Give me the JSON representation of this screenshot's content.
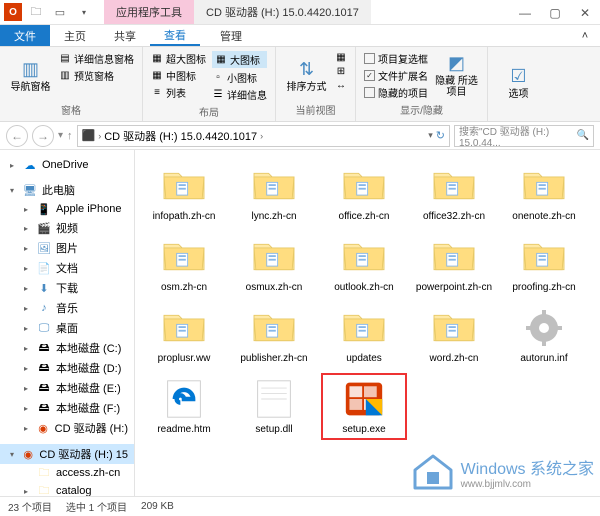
{
  "titlebar": {
    "tool_tab": "应用程序工具",
    "title": "CD 驱动器 (H:) 15.0.4420.1017",
    "manage": "管理"
  },
  "tabs": {
    "file": "文件",
    "home": "主页",
    "share": "共享",
    "view": "查看"
  },
  "ribbon": {
    "nav_pane": "导航窗格",
    "detail_pane": "详细信息窗格",
    "preview_pane": "预览窗格",
    "group_pane": "窗格",
    "extra_large": "超大图标",
    "large": "大图标",
    "medium": "中图标",
    "small": "小图标",
    "list": "列表",
    "details": "详细信息",
    "group_layout": "布局",
    "sort": "排序方式",
    "group_current": "当前视图",
    "item_checkboxes": "项目复选框",
    "file_ext": "文件扩展名",
    "hidden_items": "隐藏的项目",
    "hide_selected": "隐藏\n所选项目",
    "group_showhide": "显示/隐藏",
    "options": "选项"
  },
  "address": {
    "root": "CD 驱动器 (H:) 15.0.4420.1017",
    "search_placeholder": "搜索\"CD 驱动器 (H:) 15.0.44..."
  },
  "sidebar": {
    "onedrive": "OneDrive",
    "this_pc": "此电脑",
    "iphone": "Apple iPhone",
    "videos": "视频",
    "pictures": "图片",
    "documents": "文档",
    "downloads": "下载",
    "music": "音乐",
    "desktop": "桌面",
    "drive_c": "本地磁盘 (C:)",
    "drive_d": "本地磁盘 (D:)",
    "drive_e": "本地磁盘 (E:)",
    "drive_f": "本地磁盘 (F:)",
    "cd_h": "CD 驱动器 (H:)",
    "cd_h_full": "CD 驱动器 (H:) 15",
    "access": "access.zh-cn",
    "catalog": "catalog"
  },
  "items": [
    {
      "name": "infopath.zh-cn",
      "type": "folder"
    },
    {
      "name": "lync.zh-cn",
      "type": "folder"
    },
    {
      "name": "office.zh-cn",
      "type": "folder"
    },
    {
      "name": "office32.zh-cn",
      "type": "folder"
    },
    {
      "name": "onenote.zh-cn",
      "type": "folder"
    },
    {
      "name": "osm.zh-cn",
      "type": "folder"
    },
    {
      "name": "osmux.zh-cn",
      "type": "folder"
    },
    {
      "name": "outlook.zh-cn",
      "type": "folder"
    },
    {
      "name": "powerpoint.zh-cn",
      "type": "folder"
    },
    {
      "name": "proofing.zh-cn",
      "type": "folder"
    },
    {
      "name": "proplusr.ww",
      "type": "folder"
    },
    {
      "name": "publisher.zh-cn",
      "type": "folder"
    },
    {
      "name": "updates",
      "type": "folder"
    },
    {
      "name": "word.zh-cn",
      "type": "folder"
    },
    {
      "name": "autorun.inf",
      "type": "gear"
    },
    {
      "name": "readme.htm",
      "type": "edge"
    },
    {
      "name": "setup.dll",
      "type": "blank"
    },
    {
      "name": "setup.exe",
      "type": "office",
      "highlight": true
    }
  ],
  "status": {
    "count": "23 个项目",
    "selected": "选中 1 个项目",
    "size": "209 KB"
  },
  "watermark": {
    "text": "Windows 系统之家",
    "url": "www.bjjmlv.com"
  }
}
